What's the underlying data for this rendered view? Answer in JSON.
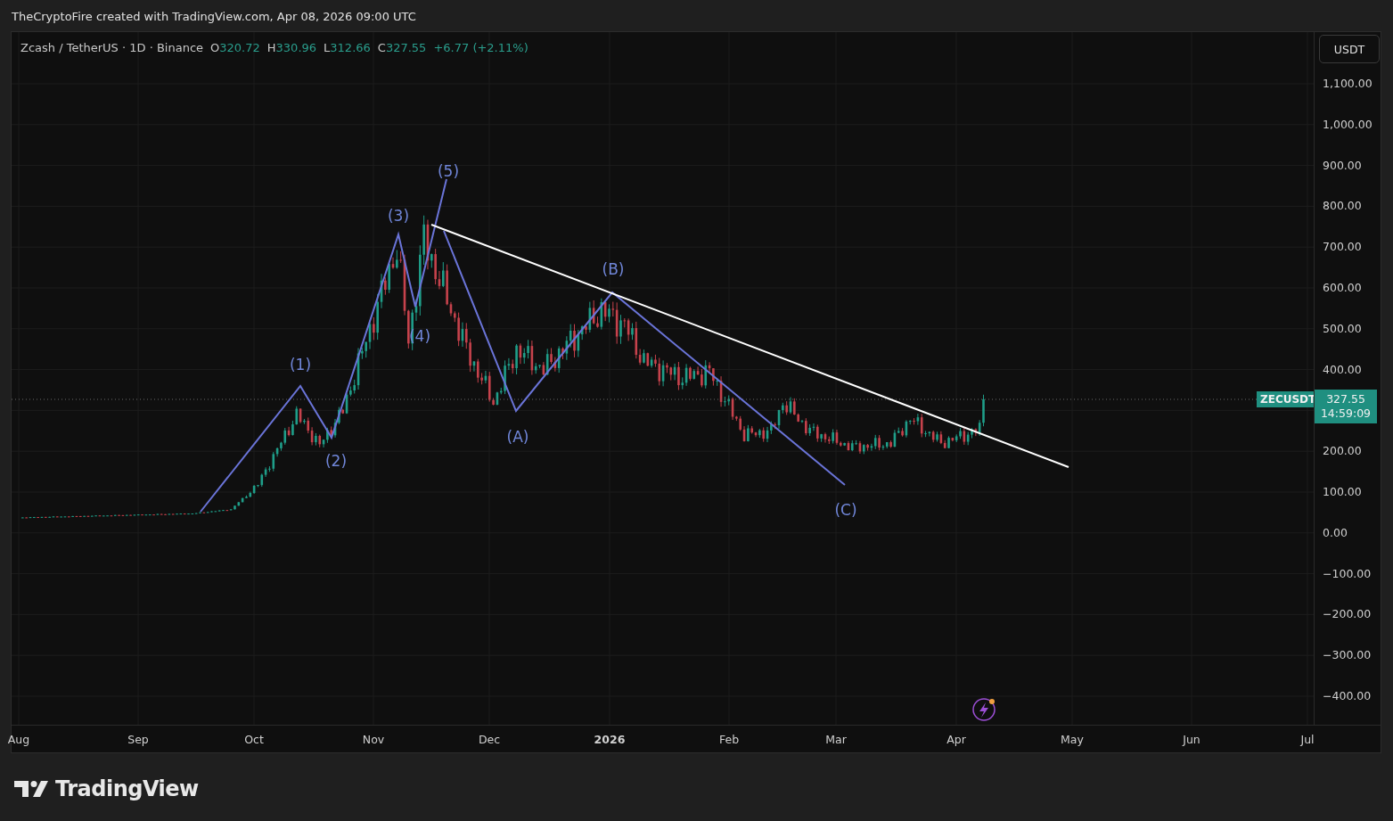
{
  "header": {
    "caption": "TheCryptoFire created with TradingView.com, Apr 08, 2026 09:00 UTC"
  },
  "legend": {
    "symbol": "Zcash / TetherUS · 1D · Binance",
    "ohlc": [
      {
        "label": "O",
        "value": "320.72"
      },
      {
        "label": "H",
        "value": "330.96"
      },
      {
        "label": "L",
        "value": "312.66"
      },
      {
        "label": "C",
        "value": "327.55"
      }
    ],
    "change": "+6.77 (+2.11%)"
  },
  "currency_button": "USDT",
  "price_axis": [
    "1,100.00",
    "1,000.00",
    "900.00",
    "800.00",
    "700.00",
    "600.00",
    "500.00",
    "400.00",
    "200.00",
    "100.00",
    "0.00",
    "−100.00",
    "−200.00",
    "−300.00",
    "−400.00"
  ],
  "price_tag": {
    "symbol": "ZECUSDT",
    "price": "327.55",
    "countdown": "14:59:09"
  },
  "wave_labels": [
    "(1)",
    "(2)",
    "(3)",
    "(4)",
    "(5)",
    "(A)",
    "(B)",
    "(C)"
  ],
  "time_axis": [
    {
      "label": "Aug",
      "kind": "month"
    },
    {
      "label": "Sep",
      "kind": "month"
    },
    {
      "label": "Oct",
      "kind": "month"
    },
    {
      "label": "Nov",
      "kind": "month"
    },
    {
      "label": "Dec",
      "kind": "month"
    },
    {
      "label": "2026",
      "kind": "year"
    },
    {
      "label": "Feb",
      "kind": "month"
    },
    {
      "label": "Mar",
      "kind": "month"
    },
    {
      "label": "Apr",
      "kind": "month"
    },
    {
      "label": "May",
      "kind": "month"
    },
    {
      "label": "Jun",
      "kind": "month"
    },
    {
      "label": "Jul",
      "kind": "month"
    }
  ],
  "footer": {
    "logo": "TradingView"
  }
}
